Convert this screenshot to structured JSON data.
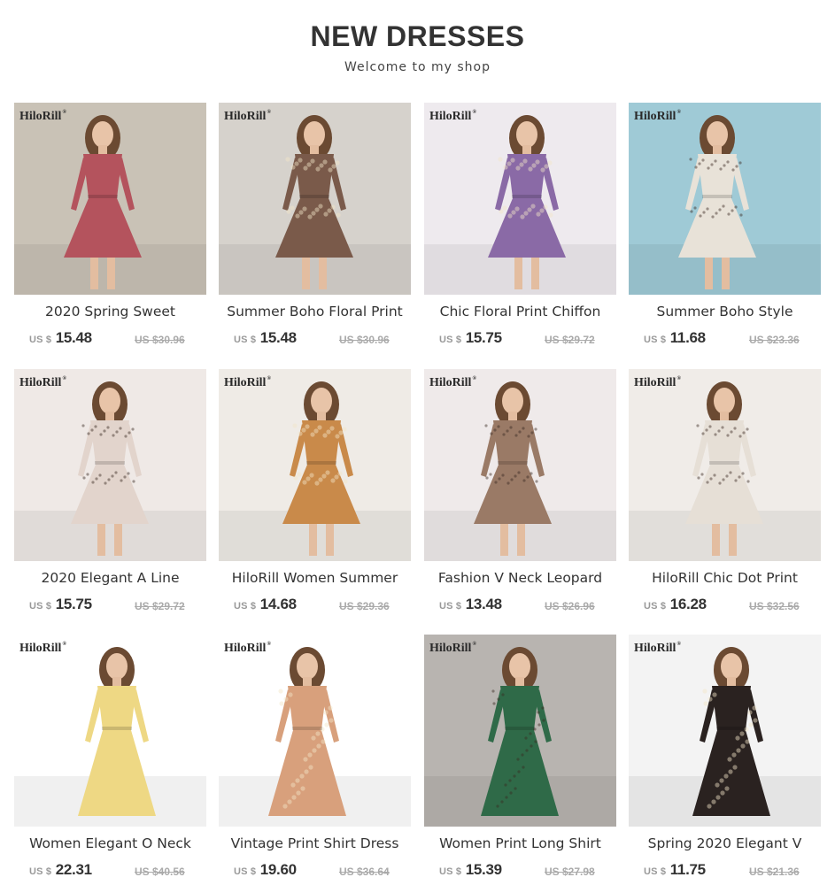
{
  "header": {
    "title": "NEW DRESSES",
    "subtitle": "Welcome to my shop"
  },
  "brand_watermark": "HiloRill",
  "currency": "US $",
  "products": [
    {
      "name": "2020 Spring Sweet",
      "price": "15.48",
      "original_price": "US $30.96",
      "dress_color": "#b4535d",
      "bg": "#c9c2b6",
      "pattern": "solid"
    },
    {
      "name": "Summer Boho Floral Print",
      "price": "15.48",
      "original_price": "US $30.96",
      "dress_color": "#7a5a4a",
      "bg": "#d6d2cc",
      "pattern": "floral"
    },
    {
      "name": "Chic Floral Print Chiffon",
      "price": "15.75",
      "original_price": "US $29.72",
      "dress_color": "#8a6aa6",
      "bg": "#eeeaee",
      "pattern": "floral"
    },
    {
      "name": "Summer Boho Style",
      "price": "11.68",
      "original_price": "US $23.36",
      "dress_color": "#e8e2d8",
      "bg": "#9fcad6",
      "pattern": "dots"
    },
    {
      "name": "2020 Elegant A Line",
      "price": "15.75",
      "original_price": "US $29.72",
      "dress_color": "#e2d4cc",
      "bg": "#efe9e6",
      "pattern": "dots"
    },
    {
      "name": "HiloRill Women Summer",
      "price": "14.68",
      "original_price": "US $29.36",
      "dress_color": "#c98a4a",
      "bg": "#efebe6",
      "pattern": "floral"
    },
    {
      "name": "Fashion V Neck Leopard",
      "price": "13.48",
      "original_price": "US $26.96",
      "dress_color": "#9a7a66",
      "bg": "#efeaea",
      "pattern": "dots"
    },
    {
      "name": "HiloRill Chic Dot Print",
      "price": "16.28",
      "original_price": "US $32.56",
      "dress_color": "#e6dfd6",
      "bg": "#f0ece8",
      "pattern": "dots"
    },
    {
      "name": "Women Elegant O Neck",
      "price": "22.31",
      "original_price": "US $40.56",
      "dress_color": "#eed884",
      "bg": "#ffffff",
      "pattern": "solid"
    },
    {
      "name": "Vintage Print Shirt Dress",
      "price": "19.60",
      "original_price": "US $36.64",
      "dress_color": "#d8a07c",
      "bg": "#ffffff",
      "pattern": "floral"
    },
    {
      "name": "Women Print Long Shirt",
      "price": "15.39",
      "original_price": "US $27.98",
      "dress_color": "#2f6a48",
      "bg": "#b8b4b0",
      "pattern": "dots"
    },
    {
      "name": "Spring 2020 Elegant V",
      "price": "11.75",
      "original_price": "US $21.36",
      "dress_color": "#2a2220",
      "bg": "#f3f3f3",
      "pattern": "floral"
    }
  ]
}
